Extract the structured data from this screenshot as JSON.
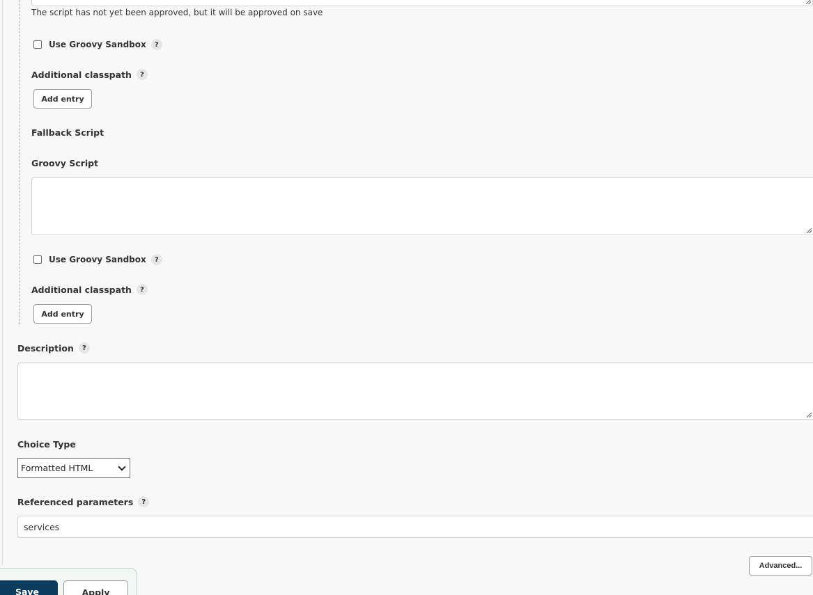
{
  "script_section": {
    "approval_note": "The script has not yet been approved, but it will be approved on save",
    "sandbox_label": "Use Groovy Sandbox",
    "sandbox_checked": false,
    "classpath_label": "Additional classpath",
    "add_entry_label": "Add entry",
    "help_glyph": "?"
  },
  "fallback_section": {
    "title": "Fallback Script",
    "groovy_script_label": "Groovy Script",
    "groovy_script_value": "",
    "sandbox_label": "Use Groovy Sandbox",
    "sandbox_checked": false,
    "classpath_label": "Additional classpath",
    "add_entry_label": "Add entry"
  },
  "description": {
    "label": "Description",
    "value": ""
  },
  "choice_type": {
    "label": "Choice Type",
    "selected": "Formatted HTML"
  },
  "referenced_parameters": {
    "label": "Referenced parameters",
    "value": "services"
  },
  "buttons": {
    "advanced": "Advanced...",
    "save": "Save",
    "apply": "Apply"
  }
}
